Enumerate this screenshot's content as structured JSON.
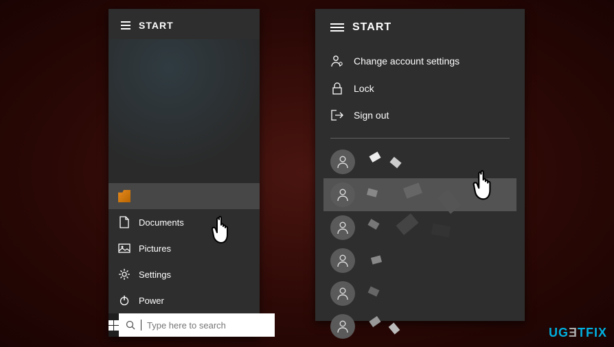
{
  "left_panel": {
    "title": "START",
    "user_item_label": "",
    "items": [
      {
        "label": "Documents"
      },
      {
        "label": "Pictures"
      },
      {
        "label": "Settings"
      },
      {
        "label": "Power"
      }
    ],
    "search_placeholder": "Type here to search"
  },
  "right_panel": {
    "title": "START",
    "menu": [
      {
        "label": "Change account settings"
      },
      {
        "label": "Lock"
      },
      {
        "label": "Sign out"
      }
    ],
    "users_count": 6
  },
  "watermark": {
    "part1": "UG",
    "part2": "Ǝ",
    "part3": "TFIX"
  }
}
